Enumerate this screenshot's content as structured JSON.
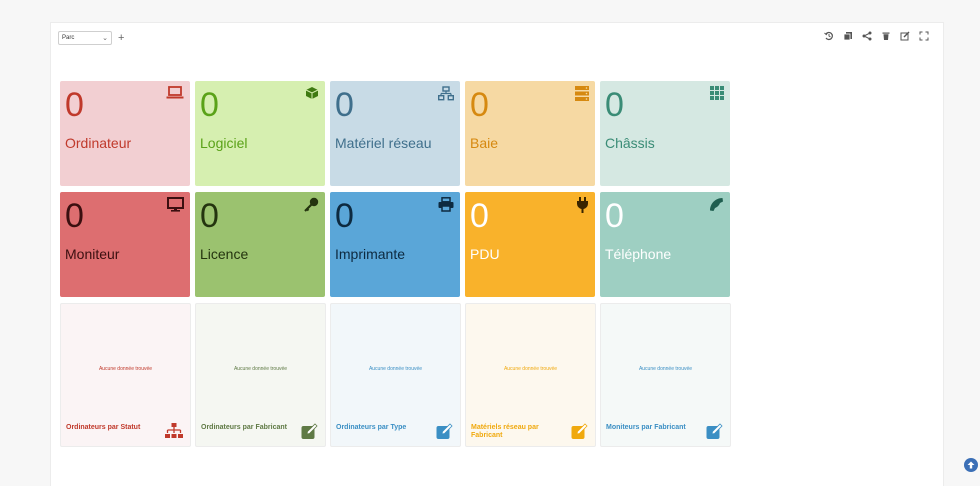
{
  "toolbar": {
    "dashboard_select": "Parc",
    "add_label": "+"
  },
  "toolbar_icons": [
    "history-icon",
    "copy-icon",
    "share-icon",
    "trash-icon",
    "edit-icon",
    "fullscreen-icon"
  ],
  "cards": [
    {
      "count": "0",
      "label": "Ordinateur",
      "icon": "laptop-icon",
      "bg": "#f2cfd2",
      "fg": "#c0392b"
    },
    {
      "count": "0",
      "label": "Logiciel",
      "icon": "cube-icon",
      "bg": "#d6efb0",
      "fg": "#5aa218"
    },
    {
      "count": "0",
      "label": "Matériel réseau",
      "icon": "network-icon",
      "bg": "#c8dbe6",
      "fg": "#3f6f8c"
    },
    {
      "count": "0",
      "label": "Baie",
      "icon": "server-icon",
      "bg": "#f6d9a3",
      "fg": "#d68910"
    },
    {
      "count": "0",
      "label": "Châssis",
      "icon": "grid-icon",
      "bg": "#d5e8e2",
      "fg": "#3a8c76"
    },
    {
      "count": "0",
      "label": "Moniteur",
      "icon": "monitor-icon",
      "bg": "#dd6e70",
      "fg": "#3b0f10"
    },
    {
      "count": "0",
      "label": "Licence",
      "icon": "key-icon",
      "bg": "#9bc26f",
      "fg": "#24340f"
    },
    {
      "count": "0",
      "label": "Imprimante",
      "icon": "printer-icon",
      "bg": "#5aa6d8",
      "fg": "#0d2a40"
    },
    {
      "count": "0",
      "label": "PDU",
      "icon": "plug-icon",
      "bg": "#f9b22b",
      "fg": "#ffffff"
    },
    {
      "count": "0",
      "label": "Téléphone",
      "icon": "phone-icon",
      "bg": "#9ecfc2",
      "fg": "#ffffff"
    }
  ],
  "graphs": [
    {
      "title": "Ordinateurs par Statut",
      "no_data": "Aucune donnée trouvée",
      "icon": "sitemap-icon",
      "color": "#c0392b",
      "bg": "#fbf4f5"
    },
    {
      "title": "Ordinateurs par Fabricant",
      "no_data": "Aucune donnée trouvée",
      "icon": "edit-icon",
      "color": "#5f7a45",
      "bg": "#f5f7f2"
    },
    {
      "title": "Ordinateurs par Type",
      "no_data": "Aucune donnée trouvée",
      "icon": "edit-icon",
      "color": "#3b8fc4",
      "bg": "#f2f7fa"
    },
    {
      "title": "Matériels réseau par Fabricant",
      "no_data": "Aucune donnée trouvée",
      "icon": "edit-icon",
      "color": "#f0a90e",
      "bg": "#fdf8ee"
    },
    {
      "title": "Moniteurs par Fabricant",
      "no_data": "Aucune donnée trouvée",
      "icon": "edit-icon",
      "color": "#3b8fc4",
      "bg": "#f5f9f8"
    }
  ]
}
